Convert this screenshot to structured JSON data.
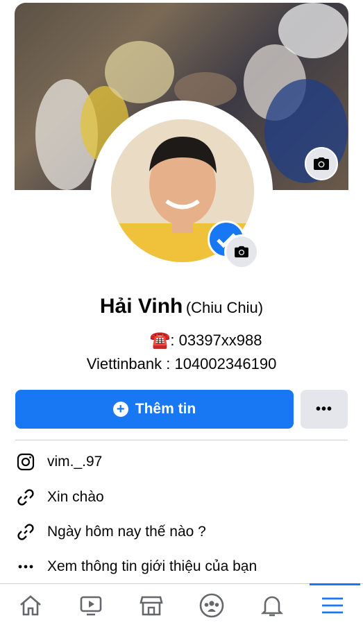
{
  "profile": {
    "name": "Hải Vinh",
    "alternate_name": "(Chiu Chiu)",
    "phone_emoji": "☎️",
    "phone_text": ": 03397xx988",
    "bank_text": "Viettinbank : 104002346190"
  },
  "actions": {
    "add_story_label": "Thêm tin",
    "more_label": "•••"
  },
  "info_items": [
    {
      "icon": "instagram-icon",
      "text": "vim._.97"
    },
    {
      "icon": "link-icon",
      "text": "Xin chào"
    },
    {
      "icon": "link-icon",
      "text": "Ngày hôm nay thế nào ?"
    },
    {
      "icon": "more-dots-icon",
      "text": "Xem thông tin giới thiệu của bạn"
    }
  ],
  "bottom_nav": [
    {
      "icon": "home-icon",
      "active": false
    },
    {
      "icon": "watch-icon",
      "active": false
    },
    {
      "icon": "marketplace-icon",
      "active": false
    },
    {
      "icon": "groups-icon",
      "active": false
    },
    {
      "icon": "notifications-icon",
      "active": false
    },
    {
      "icon": "menu-icon",
      "active": true
    }
  ],
  "colors": {
    "accent": "#1877f2",
    "secondary_button": "#e4e6eb",
    "icon_gray": "#65676b"
  }
}
